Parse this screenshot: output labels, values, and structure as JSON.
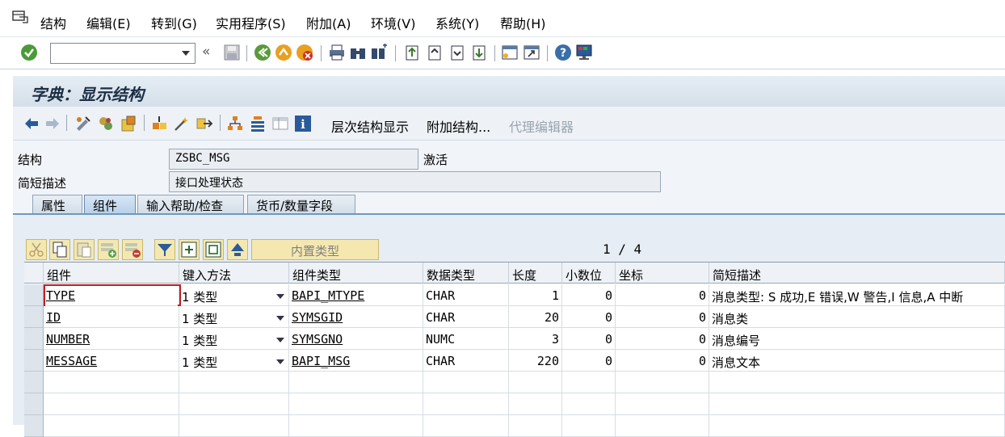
{
  "menu": [
    "结构",
    "编辑(E)",
    "转到(G)",
    "实用程序(S)",
    "附加(A)",
    "环境(V)",
    "系统(Y)",
    "帮助(H)"
  ],
  "toolbar": {
    "back_chevron": "«"
  },
  "title": "字典：显示结构",
  "app_toolbar": {
    "hier_display": "层次结构显示",
    "append_struct": "附加结构...",
    "proxy_editor": "代理编辑器"
  },
  "form": {
    "struct_label": "结构",
    "struct_value": "ZSBC_MSG",
    "status": "激活",
    "desc_label": "简短描述",
    "desc_value": "接口处理状态"
  },
  "tabs": [
    "属性",
    "组件",
    "输入帮助/检查",
    "货币/数量字段"
  ],
  "table_toolbar": {
    "builtin_type": "内置类型",
    "page_info": "1 / 4"
  },
  "columns": [
    "组件",
    "键入方法",
    "组件类型",
    "数据类型",
    "长度",
    "小数位",
    "坐标",
    "简短描述"
  ],
  "rows": [
    {
      "component": "TYPE",
      "typing": "1 类型",
      "comp_type": "BAPI_MTYPE",
      "data_type": "CHAR",
      "length": "1",
      "decimals": "0",
      "coord": "0",
      "desc": "消息类型: S 成功,E 错误,W 警告,I 信息,A 中断"
    },
    {
      "component": "ID",
      "typing": "1 类型",
      "comp_type": "SYMSGID",
      "data_type": "CHAR",
      "length": "20",
      "decimals": "0",
      "coord": "0",
      "desc": "消息类"
    },
    {
      "component": "NUMBER",
      "typing": "1 类型",
      "comp_type": "SYMSGNO",
      "data_type": "NUMC",
      "length": "3",
      "decimals": "0",
      "coord": "0",
      "desc": "消息编号"
    },
    {
      "component": "MESSAGE",
      "typing": "1 类型",
      "comp_type": "BAPI_MSG",
      "data_type": "CHAR",
      "length": "220",
      "decimals": "0",
      "coord": "0",
      "desc": "消息文本"
    }
  ],
  "colors": {
    "accent": "#6e98c0",
    "title_bg": "#d4dfea",
    "tab_active": "#b8d0e8"
  }
}
